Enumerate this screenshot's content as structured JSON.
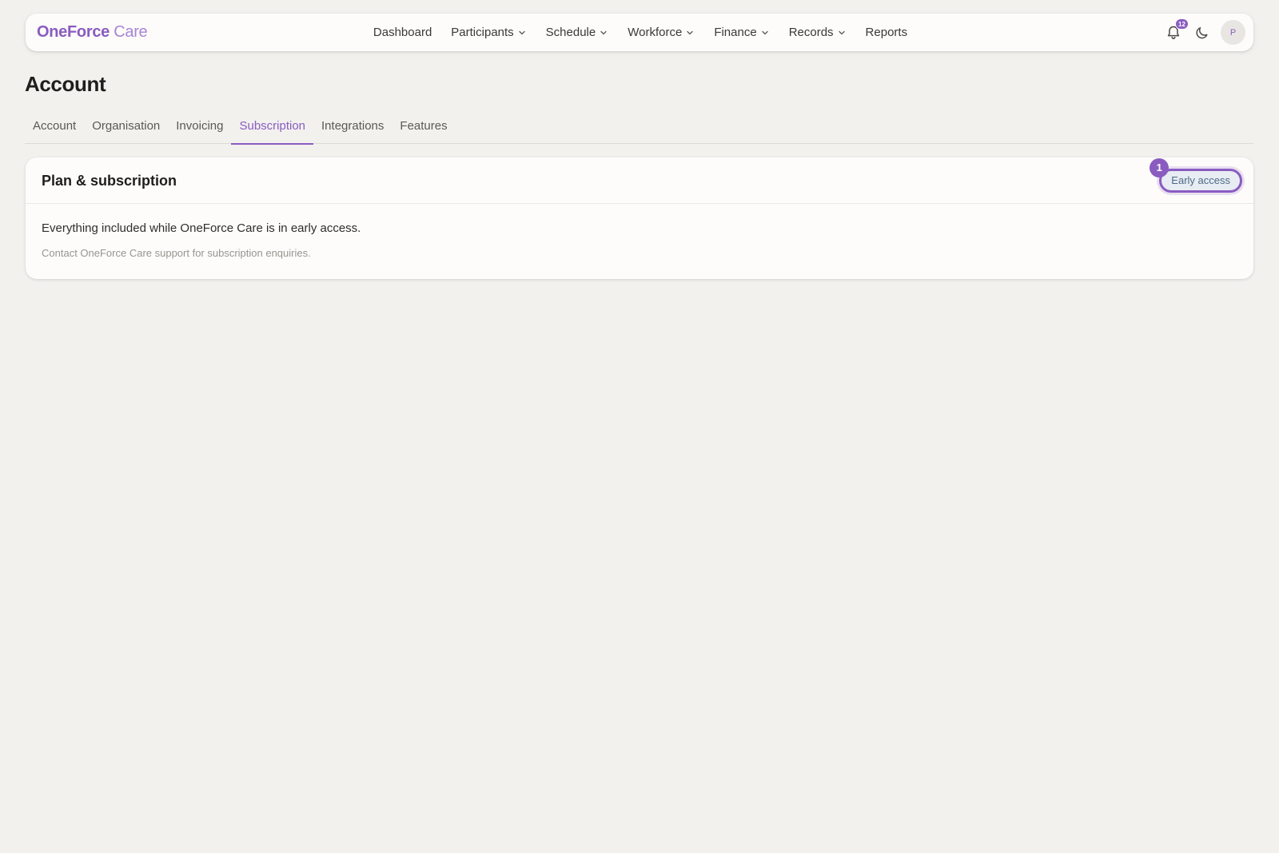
{
  "app": {
    "logo_part1": "OneForce",
    "logo_part2": "Care"
  },
  "nav": {
    "items": [
      {
        "label": "Dashboard",
        "dropdown": false
      },
      {
        "label": "Participants",
        "dropdown": true
      },
      {
        "label": "Schedule",
        "dropdown": true
      },
      {
        "label": "Workforce",
        "dropdown": true
      },
      {
        "label": "Finance",
        "dropdown": true
      },
      {
        "label": "Records",
        "dropdown": true
      },
      {
        "label": "Reports",
        "dropdown": false
      }
    ]
  },
  "header_icons": {
    "notifications_count": "12",
    "notifications_icon": "bell-icon",
    "theme_icon": "moon-icon",
    "avatar_initial": "P"
  },
  "page": {
    "title": "Account"
  },
  "tabs": [
    {
      "label": "Account",
      "active": false
    },
    {
      "label": "Organisation",
      "active": false
    },
    {
      "label": "Invoicing",
      "active": false
    },
    {
      "label": "Subscription",
      "active": true
    },
    {
      "label": "Integrations",
      "active": false
    },
    {
      "label": "Features",
      "active": false
    }
  ],
  "card": {
    "title": "Plan & subscription",
    "badge_label": "Early access",
    "step_marker": "1",
    "description": "Everything included while OneForce Care is in early access.",
    "note": "Contact OneForce Care support for subscription enquiries."
  },
  "colors": {
    "accent": "#8a5cc0",
    "background": "#f2f1ee",
    "surface": "#fdfcfa",
    "badge_bg": "#e8ecf3",
    "badge_text": "#4c6a88"
  }
}
